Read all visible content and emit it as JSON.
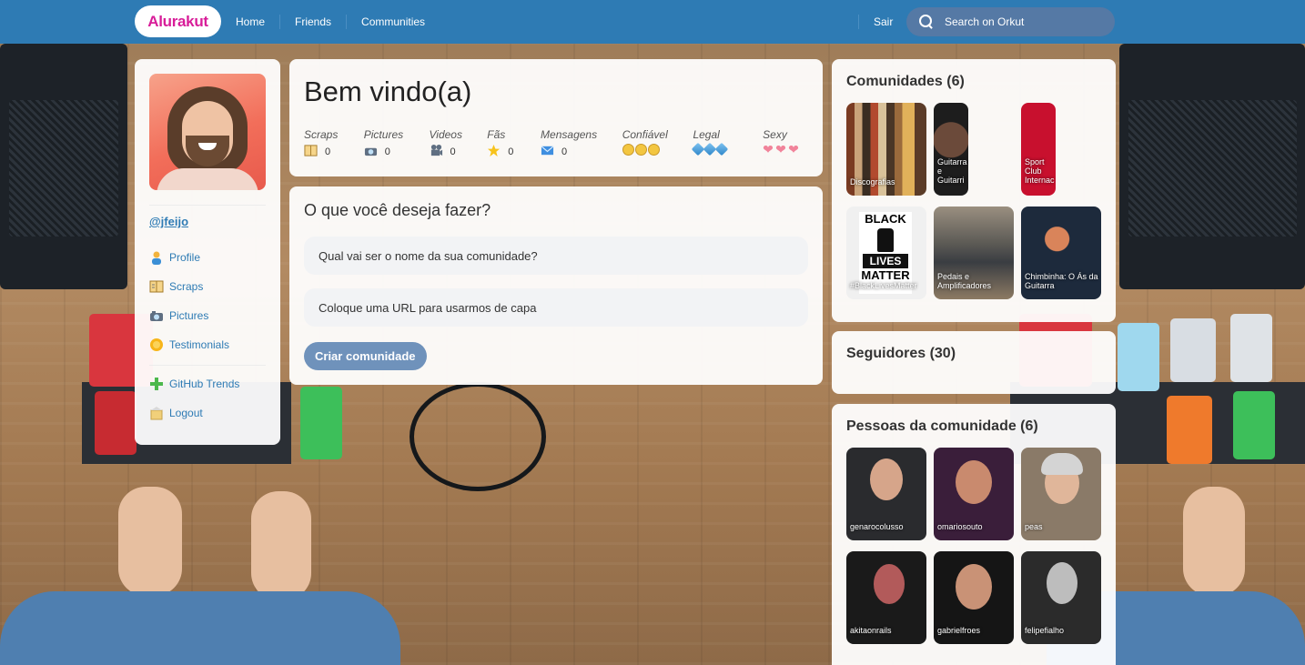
{
  "app": {
    "logo": "Alurakut"
  },
  "nav": {
    "links": [
      "Home",
      "Friends",
      "Communities"
    ],
    "logout": "Sair",
    "search_placeholder": "Search on Orkut"
  },
  "profile": {
    "username": "@jfeijo",
    "menu": [
      {
        "label": "Profile",
        "icon": "user-icon"
      },
      {
        "label": "Scraps",
        "icon": "book-icon"
      },
      {
        "label": "Pictures",
        "icon": "camera-icon"
      },
      {
        "label": "Testimonials",
        "icon": "sun-icon"
      }
    ],
    "menu2": [
      {
        "label": "GitHub Trends",
        "icon": "plus-icon"
      },
      {
        "label": "Logout",
        "icon": "logout-icon"
      }
    ]
  },
  "welcome": {
    "title": "Bem vindo(a)",
    "stats": [
      {
        "label": "Scraps",
        "value": "0",
        "icon": "book-icon"
      },
      {
        "label": "Pictures",
        "value": "0",
        "icon": "camera-icon"
      },
      {
        "label": "Videos",
        "value": "0",
        "icon": "video-camera-icon"
      },
      {
        "label": "Fãs",
        "value": "0",
        "icon": "star-icon"
      },
      {
        "label": "Mensagens",
        "value": "0",
        "icon": "envelope-icon"
      }
    ],
    "ratings": [
      {
        "label": "Confiável",
        "icon": "smiley-icon",
        "count": 3
      },
      {
        "label": "Legal",
        "icon": "cube-icon",
        "count": 3
      },
      {
        "label": "Sexy",
        "icon": "heart-icon",
        "count": 3
      }
    ]
  },
  "form": {
    "title": "O que você deseja fazer?",
    "name_placeholder": "Qual vai ser o nome da sua comunidade?",
    "url_placeholder": "Coloque uma URL para usarmos de capa",
    "submit_label": "Criar comunidade"
  },
  "communities": {
    "title": "Comunidades (6)",
    "items": [
      {
        "name": "Discografias"
      },
      {
        "name": "Guitarra e Guitarri"
      },
      {
        "name": "Sport Club Internac"
      },
      {
        "name": "#BlackLivesMatter"
      },
      {
        "name": "Pedais e Amplificadores"
      },
      {
        "name": "Chimbinha: O Ás da Guitarra"
      }
    ],
    "blm_text": {
      "line1": "BLACK",
      "line2": "LIVES",
      "line3": "MATTER"
    }
  },
  "followers": {
    "title": "Seguidores (30)"
  },
  "people": {
    "title": "Pessoas da comunidade (6)",
    "items": [
      {
        "name": "genarocolusso"
      },
      {
        "name": "omariosouto"
      },
      {
        "name": "peas"
      },
      {
        "name": "akitaonrails"
      },
      {
        "name": "gabrielfroes"
      },
      {
        "name": "felipefialho"
      }
    ]
  },
  "colors": {
    "topbar": "#2e7bb4",
    "logo_text": "#d81d99",
    "link": "#2e7bb4",
    "button": "#6f92bb",
    "search_bg": "#5579a5"
  }
}
